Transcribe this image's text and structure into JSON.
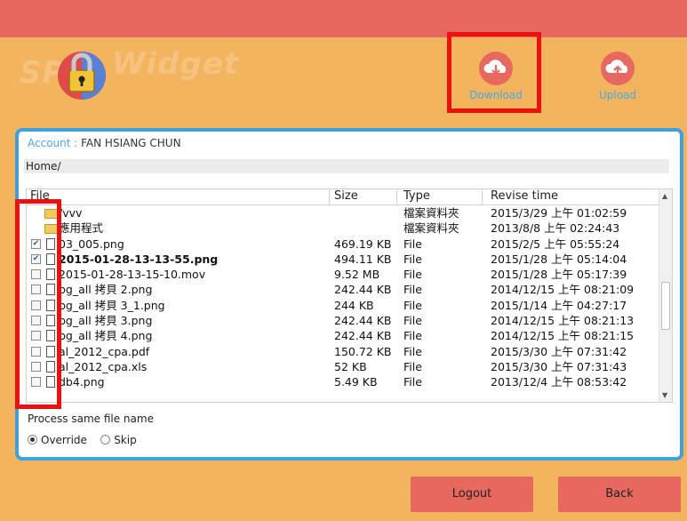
{
  "brand": {
    "logo_sp": "SP",
    "logo_widget": "Widget"
  },
  "toolbar": {
    "download_label": "Download",
    "upload_label": "Upload"
  },
  "account": {
    "label": "Account : ",
    "name": "FAN HSIANG CHUN"
  },
  "path": "Home/",
  "columns": {
    "file": "File",
    "size": "Size",
    "type": "Type",
    "revise": "Revise time"
  },
  "rows": [
    {
      "name": "/vvv",
      "size": "",
      "type": "檔案資料夾",
      "time": "2015/3/29 上午 01:02:59",
      "folder": true,
      "checked": false,
      "bold": false
    },
    {
      "name": "應用程式",
      "size": "",
      "type": "檔案資料夾",
      "time": "2013/8/8 上午 02:24:43",
      "folder": true,
      "checked": false,
      "bold": false
    },
    {
      "name": "03_005.png",
      "size": "469.19 KB",
      "type": "File",
      "time": "2015/2/5 上午 05:55:24",
      "folder": false,
      "checked": true,
      "bold": false
    },
    {
      "name": "2015-01-28-13-13-55.png",
      "size": "494.11 KB",
      "type": "File",
      "time": "2015/1/28 上午 05:14:04",
      "folder": false,
      "checked": true,
      "bold": true
    },
    {
      "name": "2015-01-28-13-15-10.mov",
      "size": "9.52 MB",
      "type": "File",
      "time": "2015/1/28 上午 05:17:39",
      "folder": false,
      "checked": false,
      "bold": false
    },
    {
      "name": "bg_all 拷貝 2.png",
      "size": "242.44 KB",
      "type": "File",
      "time": "2014/12/15 上午 08:21:09",
      "folder": false,
      "checked": false,
      "bold": false
    },
    {
      "name": "bg_all 拷貝 3_1.png",
      "size": "244 KB",
      "type": "File",
      "time": "2015/1/14 上午 04:27:17",
      "folder": false,
      "checked": false,
      "bold": false
    },
    {
      "name": "bg_all 拷貝 3.png",
      "size": "242.44 KB",
      "type": "File",
      "time": "2014/12/15 上午 08:21:13",
      "folder": false,
      "checked": false,
      "bold": false
    },
    {
      "name": "bg_all 拷貝 4.png",
      "size": "242.44 KB",
      "type": "File",
      "time": "2014/12/15 上午 08:21:15",
      "folder": false,
      "checked": false,
      "bold": false
    },
    {
      "name": "al_2012_cpa.pdf",
      "size": "150.72 KB",
      "type": "File",
      "time": "2015/3/30 上午 07:31:42",
      "folder": false,
      "checked": false,
      "bold": false
    },
    {
      "name": "al_2012_cpa.xls",
      "size": "52 KB",
      "type": "File",
      "time": "2015/3/30 上午 07:31:43",
      "folder": false,
      "checked": false,
      "bold": false
    },
    {
      "name": "db4.png",
      "size": "5.49 KB",
      "type": "File",
      "time": "2013/12/4 上午 08:53:42",
      "folder": false,
      "checked": false,
      "bold": false
    }
  ],
  "process_label": "Process same file name",
  "options": {
    "override": "Override",
    "skip": "Skip",
    "selected": "Override"
  },
  "buttons": {
    "logout": "Logout",
    "back": "Back"
  },
  "colors": {
    "topbar": "#e7685f",
    "background": "#f3b45f",
    "panel_border": "#3fa0de",
    "highlight_frame": "#ee0f0f",
    "link": "#4aa7e8"
  }
}
